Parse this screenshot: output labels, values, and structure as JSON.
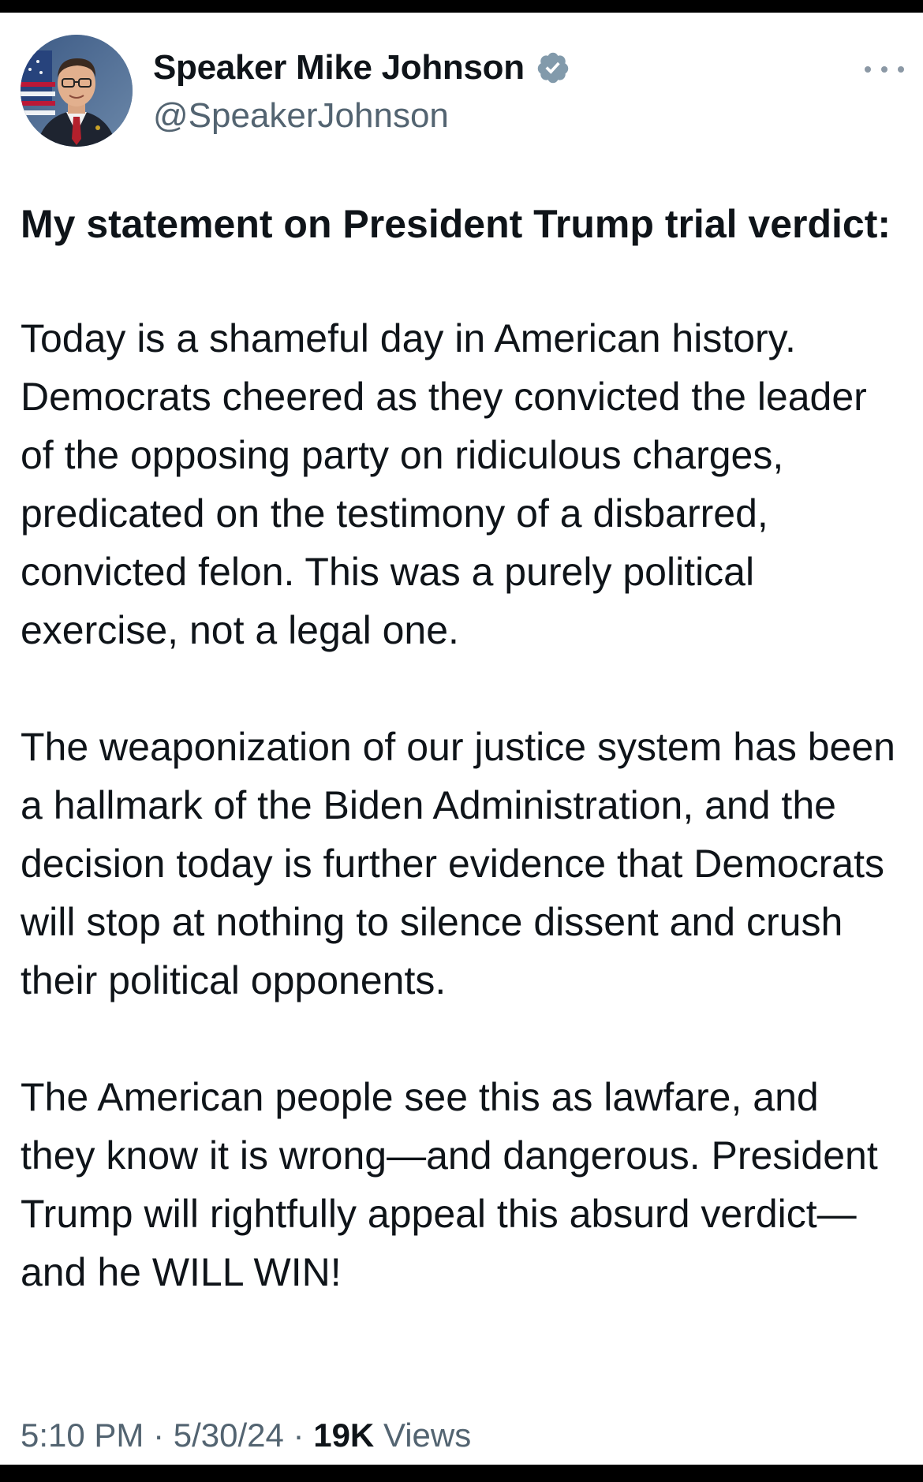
{
  "author": {
    "display_name": "Speaker Mike Johnson",
    "handle": "@SpeakerJohnson",
    "verified_color": "#829aab"
  },
  "tweet": {
    "heading": "My statement on President Trump trial verdict:",
    "paragraphs": [
      "Today is a shameful day in American history. Democrats cheered as they convicted the leader of the opposing party on ridiculous charges, predicated on the testimony of a disbarred, convicted felon. This was a purely political exercise, not a legal one.",
      "The weaponization of our justice system has been a hallmark of the Biden Administration, and the decision today is further evidence that Democrats will stop at nothing to silence dissent and crush their political opponents.",
      "The American people see this as lawfare, and they know it is wrong—and dangerous. President Trump will rightfully appeal this absurd verdict—and he WILL WIN!"
    ]
  },
  "meta": {
    "time": "5:10 PM",
    "separator": " · ",
    "date": "5/30/24",
    "views_count": "19K",
    "views_label": " Views"
  },
  "icons": {
    "avatar": "avatar-photo",
    "verified": "verified-badge-icon",
    "more": "more-options-icon"
  }
}
